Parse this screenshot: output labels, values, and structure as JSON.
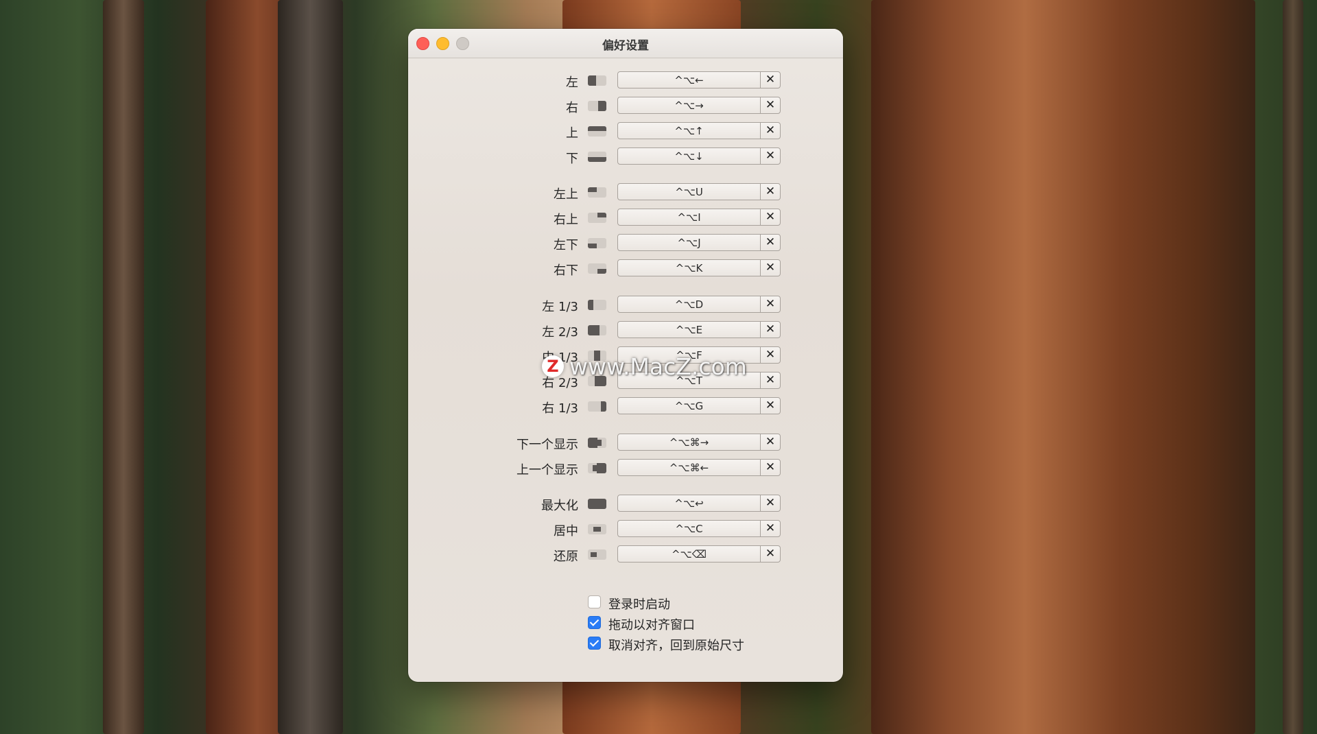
{
  "window": {
    "title": "偏好设置"
  },
  "shortcuts": [
    {
      "label": "左",
      "keys": "^⌥←",
      "icon": "left-half-icon"
    },
    {
      "label": "右",
      "keys": "^⌥→",
      "icon": "right-half-icon"
    },
    {
      "label": "上",
      "keys": "^⌥↑",
      "icon": "top-half-icon"
    },
    {
      "label": "下",
      "keys": "^⌥↓",
      "icon": "bottom-half-icon"
    },
    {
      "label": "左上",
      "keys": "^⌥U",
      "icon": "top-left-quarter-icon"
    },
    {
      "label": "右上",
      "keys": "^⌥I",
      "icon": "top-right-quarter-icon"
    },
    {
      "label": "左下",
      "keys": "^⌥J",
      "icon": "bottom-left-quarter-icon"
    },
    {
      "label": "右下",
      "keys": "^⌥K",
      "icon": "bottom-right-quarter-icon"
    },
    {
      "label": "左 1/3",
      "keys": "^⌥D",
      "icon": "left-third-icon"
    },
    {
      "label": "左 2/3",
      "keys": "^⌥E",
      "icon": "left-two-thirds-icon"
    },
    {
      "label": "中 1/3",
      "keys": "^⌥F",
      "icon": "center-third-icon"
    },
    {
      "label": "右 2/3",
      "keys": "^⌥T",
      "icon": "right-two-thirds-icon"
    },
    {
      "label": "右 1/3",
      "keys": "^⌥G",
      "icon": "right-third-icon"
    },
    {
      "label": "下一个显示",
      "keys": "^⌥⌘→",
      "icon": "next-display-icon"
    },
    {
      "label": "上一个显示",
      "keys": "^⌥⌘←",
      "icon": "previous-display-icon"
    },
    {
      "label": "最大化",
      "keys": "^⌥↩",
      "icon": "maximize-icon"
    },
    {
      "label": "居中",
      "keys": "^⌥C",
      "icon": "center-icon"
    },
    {
      "label": "还原",
      "keys": "^⌥⌫",
      "icon": "restore-icon"
    }
  ],
  "clear_glyph": "✕",
  "options": [
    {
      "label": "登录时启动",
      "checked": false
    },
    {
      "label": "拖动以对齐窗口",
      "checked": true
    },
    {
      "label": "取消对齐，回到原始尺寸",
      "checked": true
    }
  ],
  "watermark": {
    "logo": "Z",
    "text": "www.MacZ.com"
  },
  "colors": {
    "accent": "#2a7cf6",
    "close": "#fe5f57",
    "minimize": "#febc2e"
  }
}
